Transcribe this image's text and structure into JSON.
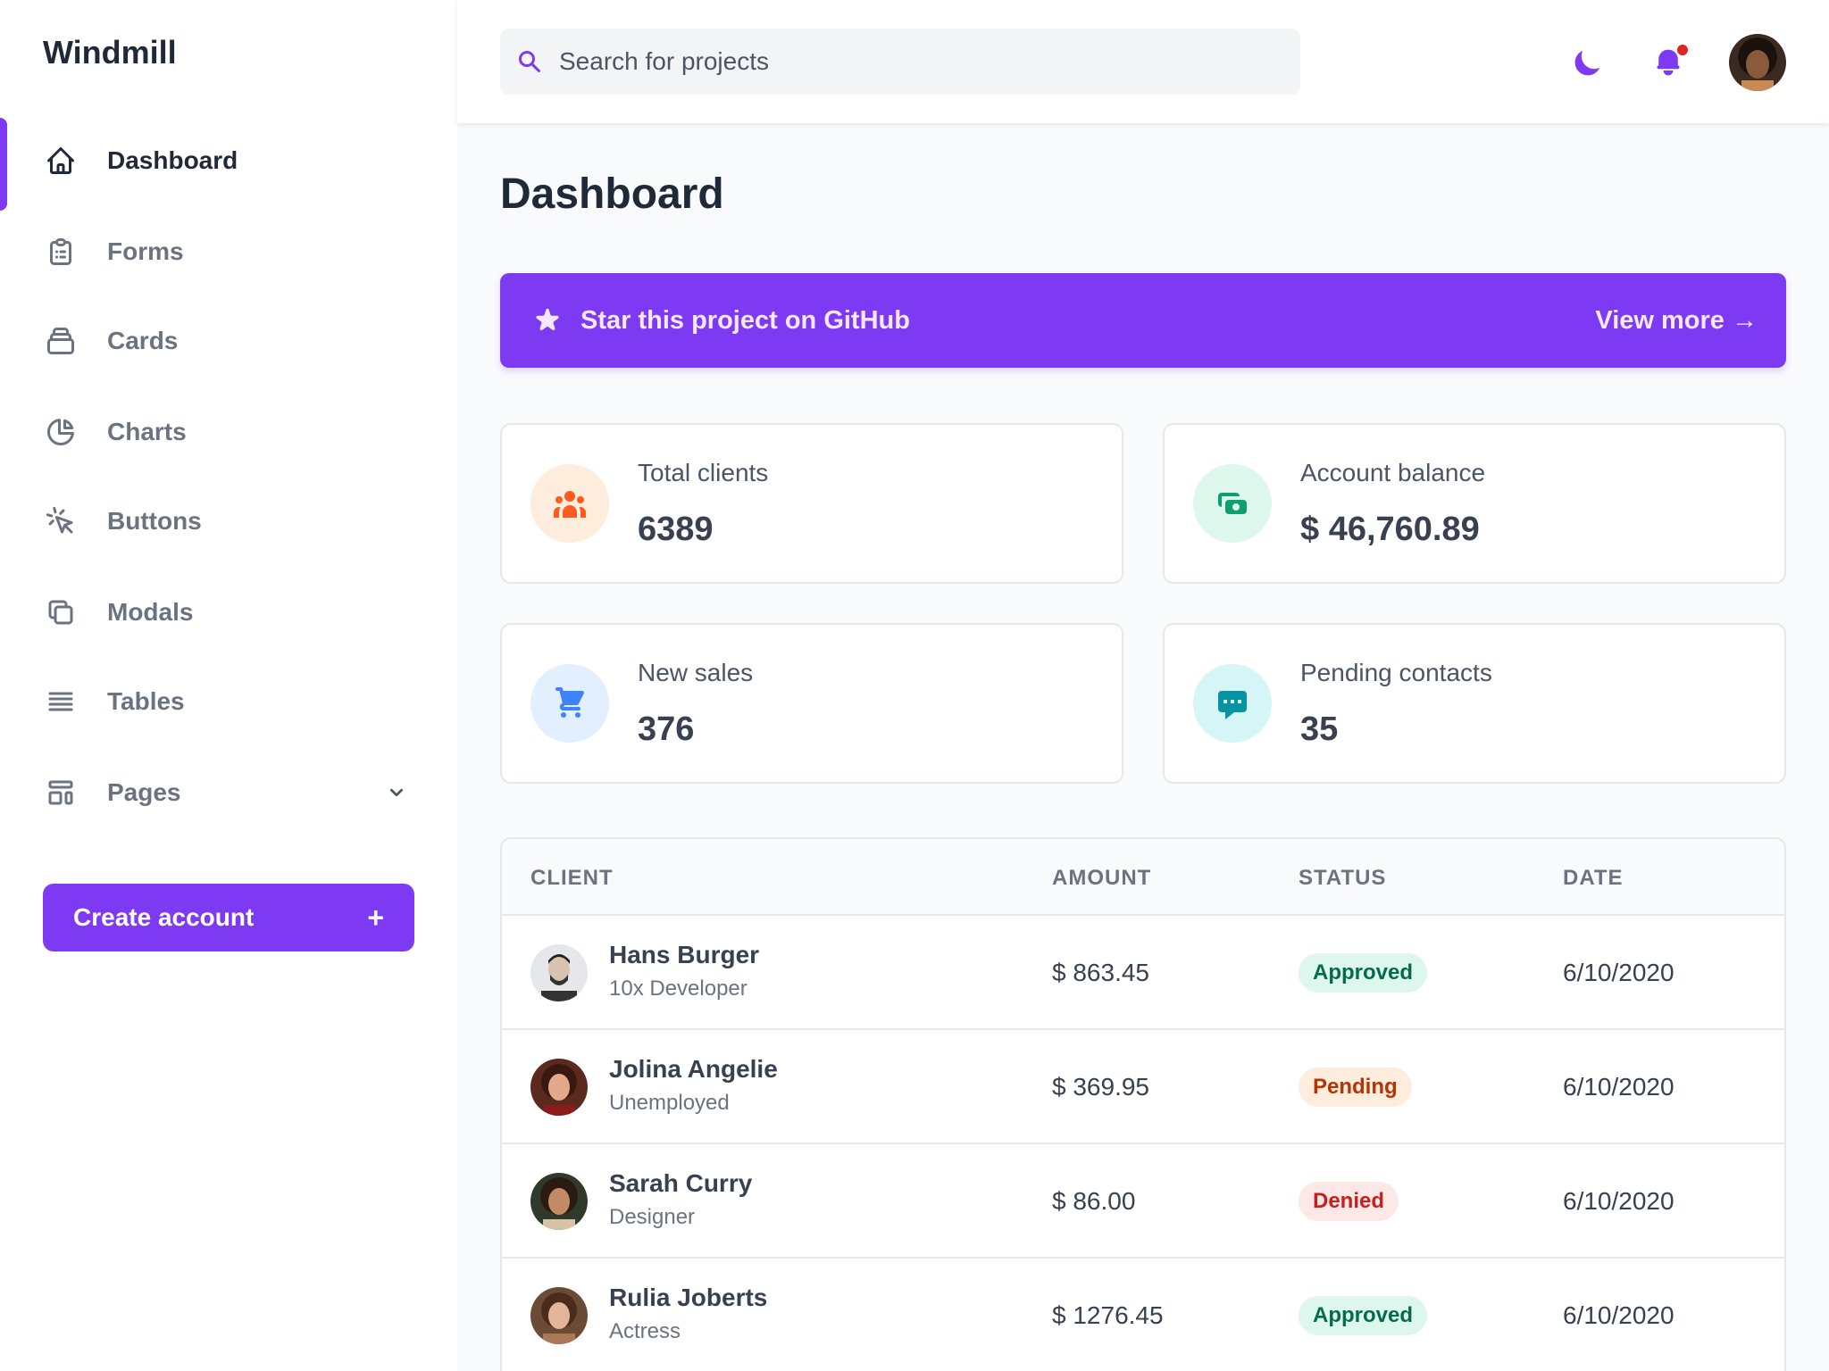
{
  "brand": "Windmill",
  "sidebar": {
    "items": [
      {
        "label": "Dashboard",
        "icon": "home-icon"
      },
      {
        "label": "Forms",
        "icon": "clipboard-icon"
      },
      {
        "label": "Cards",
        "icon": "cards-icon"
      },
      {
        "label": "Charts",
        "icon": "pie-chart-icon"
      },
      {
        "label": "Buttons",
        "icon": "cursor-click-icon"
      },
      {
        "label": "Modals",
        "icon": "duplicate-icon"
      },
      {
        "label": "Tables",
        "icon": "menu-lines-icon"
      },
      {
        "label": "Pages",
        "icon": "template-icon"
      }
    ],
    "create_button": {
      "label": "Create account",
      "plus": "+"
    }
  },
  "header": {
    "search_placeholder": "Search for projects"
  },
  "main": {
    "title": "Dashboard",
    "banner": {
      "label": "Star this project on GitHub",
      "link": "View more →"
    },
    "cards": [
      {
        "label": "Total clients",
        "value": "6389",
        "icon": "users-icon",
        "color": "#ff5a1f",
        "bg": "#feecdc"
      },
      {
        "label": "Account balance",
        "value": "$ 46,760.89",
        "icon": "cash-icon",
        "color": "#0e9f6e",
        "bg": "#def7ec"
      },
      {
        "label": "New sales",
        "value": "376",
        "icon": "cart-icon",
        "color": "#3f83f8",
        "bg": "#e1effe"
      },
      {
        "label": "Pending contacts",
        "value": "35",
        "icon": "chat-icon",
        "color": "#0694a2",
        "bg": "#d5f5f6"
      }
    ],
    "table": {
      "headers": [
        "CLIENT",
        "AMOUNT",
        "STATUS",
        "DATE"
      ],
      "rows": [
        {
          "name": "Hans Burger",
          "role": "10x Developer",
          "amount": "$ 863.45",
          "status": "Approved",
          "date": "6/10/2020"
        },
        {
          "name": "Jolina Angelie",
          "role": "Unemployed",
          "amount": "$ 369.95",
          "status": "Pending",
          "date": "6/10/2020"
        },
        {
          "name": "Sarah Curry",
          "role": "Designer",
          "amount": "$ 86.00",
          "status": "Denied",
          "date": "6/10/2020"
        },
        {
          "name": "Rulia Joberts",
          "role": "Actress",
          "amount": "$ 1276.45",
          "status": "Approved",
          "date": "6/10/2020"
        }
      ]
    }
  },
  "colors": {
    "accent": "#7e3af2",
    "approved": "#046c4e",
    "pending": "#b43403",
    "denied": "#c81e1e"
  }
}
